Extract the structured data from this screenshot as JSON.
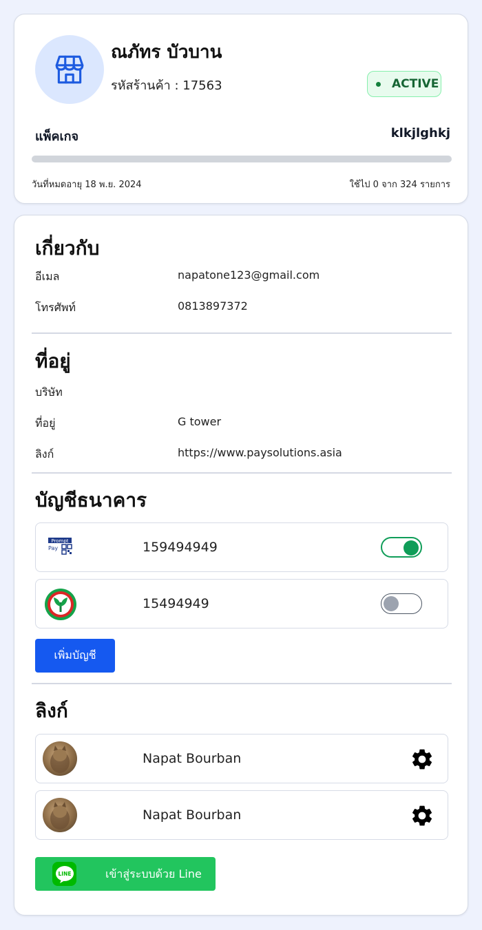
{
  "profile": {
    "name": "ณภัทร บัวบาน",
    "shop_id": "รหัสร้านค้า : 17563",
    "status": "ACTIVE",
    "package_label": "แพ็คเกจ",
    "package_value": "klkjlghkj",
    "usage_fraction": 0,
    "expiry": "วันที่หมดอายุ 18 พ.ย. 2024",
    "usage": "ใช้ไป 0 จาก 324 รายการ"
  },
  "about": {
    "title": "เกี่ยวกับ",
    "email_label": "อีเมล",
    "email_value": "napatone123@gmail.com",
    "phone_label": "โทรศัพท์",
    "phone_value": "0813897372"
  },
  "address": {
    "title": "ที่อยู่",
    "company_label": "บริษัท",
    "company_value": "",
    "address_label": "ที่อยู่",
    "address_value": "G tower",
    "link_label": "ลิงก์",
    "link_value": "https://www.paysolutions.asia"
  },
  "bank": {
    "title": "บัญชีธนาคาร",
    "accounts": [
      {
        "logo": "promptpay-logo",
        "logo_text_1": "Prompt",
        "logo_text_2": "Pay",
        "number": "159494949",
        "enabled": true
      },
      {
        "logo": "kasikorn-bank-logo",
        "number": "15494949",
        "enabled": false
      }
    ],
    "add_label": "เพิ่มบัญชี"
  },
  "links": {
    "title": "ลิงก์",
    "users": [
      {
        "name": "Napat Bourban"
      },
      {
        "name": "Napat Bourban"
      }
    ],
    "line_button_label": "เข้าสู่ระบบด้วย Line",
    "line_logo_text": "LINE"
  },
  "colors": {
    "primary": "#1559f0",
    "line_green": "#22c55e",
    "active_green": "#166534",
    "toggle_on": "#0f9d58"
  }
}
